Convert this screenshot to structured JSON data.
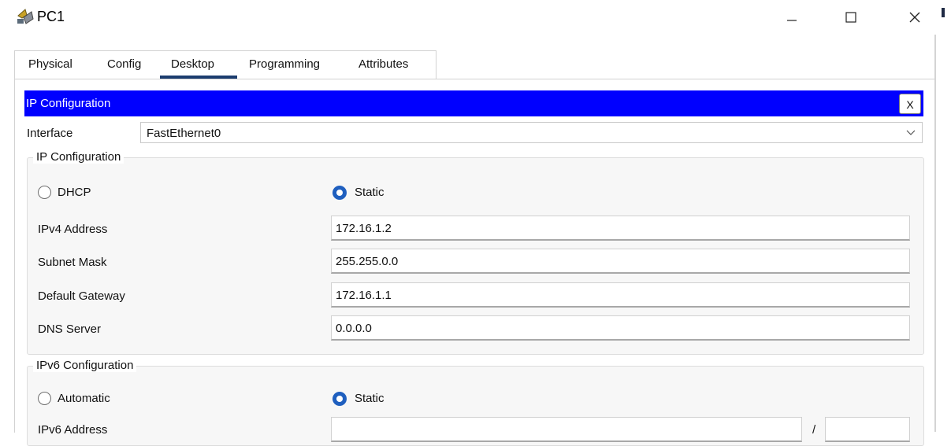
{
  "window": {
    "title": "PC1"
  },
  "tabs": [
    {
      "label": "Physical"
    },
    {
      "label": "Config"
    },
    {
      "label": "Desktop",
      "active": true
    },
    {
      "label": "Programming"
    },
    {
      "label": "Attributes"
    }
  ],
  "header": {
    "title": "IP Configuration",
    "close_label": "X",
    "color": "#0000ff"
  },
  "interface": {
    "label": "Interface",
    "value": "FastEthernet0"
  },
  "ipv4": {
    "group_title": "IP Configuration",
    "dhcp_label": "DHCP",
    "static_label": "Static",
    "mode": "Static",
    "fields": [
      {
        "label": "IPv4 Address",
        "value": "172.16.1.2"
      },
      {
        "label": "Subnet Mask",
        "value": "255.255.0.0"
      },
      {
        "label": "Default Gateway",
        "value": "172.16.1.1"
      },
      {
        "label": "DNS Server",
        "value": "0.0.0.0"
      }
    ]
  },
  "ipv6": {
    "group_title": "IPv6 Configuration",
    "auto_label": "Automatic",
    "static_label": "Static",
    "mode": "Static",
    "address_label": "IPv6 Address",
    "prefix_separator": "/"
  },
  "colors": {
    "accent": "#1f5fbf",
    "tab_underline": "#1b3c6e"
  }
}
